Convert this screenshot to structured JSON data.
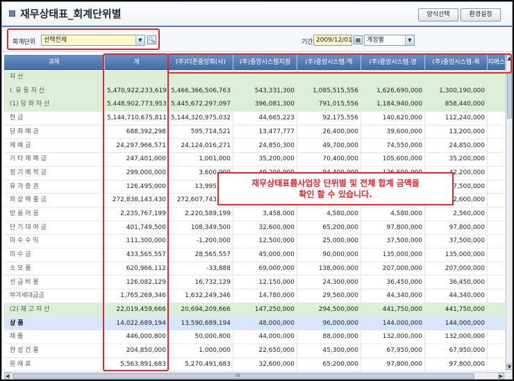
{
  "window": {
    "title": "재무상태표_회계단위별"
  },
  "toolbar": {
    "btn_style": "양식선택",
    "btn_env": "환경설정"
  },
  "filter": {
    "unit_label": "회계단위",
    "unit_value": "선택전체",
    "period_label": "기간",
    "date_value": "2009/12/01",
    "account_type_value": "계정별"
  },
  "columns": [
    "과목",
    "계",
    "(주)더존중앙회(사)",
    "(주)중앙시스템지점",
    "(주)중앙시스템-역",
    "(주)중앙시스템-영",
    "(주)중앙시스템-목",
    "지에스"
  ],
  "rows": [
    {
      "acc": "자        산",
      "v": [
        "",
        "",
        "",
        "",
        "",
        ""
      ],
      "style": "group"
    },
    {
      "acc": "Ⅰ. 유 동  자  산",
      "v": [
        "5,470,922,233,619",
        "5,466,366,506,763",
        "543,331,300",
        "1,085,515,556",
        "1,626,690,000",
        "1,300,190,000"
      ],
      "style": "group"
    },
    {
      "acc": "(1) 당  좌  자  산",
      "v": [
        "5,448,902,773,953",
        "5,445,672,297,097",
        "396,081,300",
        "791,015,556",
        "1,184,940,000",
        "858,440,000"
      ],
      "style": "group"
    },
    {
      "acc": "현             금",
      "v": [
        "5,144,710,675,811",
        "5,144,320,975,032",
        "44,665,223",
        "92,175,556",
        "140,620,000",
        "112,240,000"
      ],
      "style": "normal"
    },
    {
      "acc": "당  좌  예  금",
      "v": [
        "688,392,298",
        "595,714,521",
        "13,477,777",
        "26,400,000",
        "39,600,000",
        "13,200,000"
      ],
      "style": "normal"
    },
    {
      "acc": "제    예    금",
      "v": [
        "24,297,966,571",
        "24,124,016,271",
        "24,850,300",
        "49,700,000",
        "74,550,000",
        "24,850,000"
      ],
      "style": "normal"
    },
    {
      "acc": "기 타 제 예 금",
      "v": [
        "247,401,000",
        "1,001,000",
        "35,200,000",
        "70,400,000",
        "105,600,000",
        "35,200,000"
      ],
      "style": "normal"
    },
    {
      "acc": "정 기 예 적 금",
      "v": [
        "299,000,000",
        "3,600,000",
        "49,200,000",
        "94,400,000",
        "126,600,000",
        "42,200,000"
      ],
      "style": "normal"
    },
    {
      "acc": "유  가  증  권",
      "v": [
        "126,495,000",
        "13,995,000",
        "",
        "",
        "",
        "37,500,000"
      ],
      "style": "normal"
    },
    {
      "acc": "외 상 매 출 금",
      "v": [
        "272,838,143,430",
        "272,607,743,430",
        "",
        "",
        "",
        "52,600,000"
      ],
      "style": "normal"
    },
    {
      "acc": "받  을  어  음",
      "v": [
        "2,235,767,199",
        "2,220,589,199",
        "3,458,000",
        "4,580,000",
        "4,580,000",
        "2,560,000"
      ],
      "style": "normal"
    },
    {
      "acc": "단 기 대 여 금",
      "v": [
        "401,749,500",
        "108,349,500",
        "32,600,000",
        "65,200,000",
        "97,800,000",
        "97,800,000"
      ],
      "style": "normal"
    },
    {
      "acc": "미  수  수  익",
      "v": [
        "111,300,000",
        "-1,200,000",
        "12,500,000",
        "25,000,000",
        "37,500,000",
        "37,500,000"
      ],
      "style": "normal"
    },
    {
      "acc": "미    수    금",
      "v": [
        "433,565,557",
        "28,565,557",
        "45,000,000",
        "90,000,000",
        "135,000,000",
        "135,000,000"
      ],
      "style": "normal"
    },
    {
      "acc": "소    모    품",
      "v": [
        "620,966,112",
        "-33,888",
        "69,000,000",
        "138,000,000",
        "207,000,000",
        "207,000,000"
      ],
      "style": "normal"
    },
    {
      "acc": "선  급  비  용",
      "v": [
        "126,082,129",
        "16,732,129",
        "12,150,000",
        "24,300,000",
        "36,450,000",
        "36,450,000"
      ],
      "style": "normal"
    },
    {
      "acc": "부가세대급금",
      "v": [
        "1,765,269,346",
        "1,632,249,346",
        "14,780,000",
        "29,560,000",
        "44,340,000",
        "44,340,000"
      ],
      "style": "normal"
    },
    {
      "acc": "(2) 재  고  자  산",
      "v": [
        "22,019,459,666",
        "20,694,209,666",
        "147,250,000",
        "294,500,000",
        "441,750,000",
        "441,750,000"
      ],
      "style": "group"
    },
    {
      "acc": "상             품",
      "v": [
        "14,022,689,194",
        "13,590,689,194",
        "48,000,000",
        "96,000,000",
        "144,000,000",
        "144,000,000"
      ],
      "style": "selected"
    },
    {
      "acc": "제             품",
      "v": [
        "446,000,800",
        "50,000,800",
        "44,000,000",
        "88,000,000",
        "132,000,000",
        "132,000,000"
      ],
      "style": "normal"
    },
    {
      "acc": "완  성  건  물",
      "v": [
        "204,850,000",
        "1,000,000",
        "22,650,000",
        "45,300,000",
        "67,950,000",
        "67,950,000"
      ],
      "style": "normal"
    },
    {
      "acc": "원    재    료",
      "v": [
        "5,563,891,683",
        "5,270,491,683",
        "32,600,000",
        "65,200,000",
        "97,800,000",
        "97,800,000"
      ],
      "style": "normal"
    }
  ],
  "hscroll_label": "III",
  "callout": {
    "line1": "재무상태표를사업장 단위별 및 전체 합계 금액을",
    "line2": "확인 할 수 있습니다."
  },
  "colors": {
    "header": "#4f78b0",
    "group_row": "#dcefd6",
    "selected_row": "#d6e6fb",
    "highlight": "#e3262b"
  }
}
